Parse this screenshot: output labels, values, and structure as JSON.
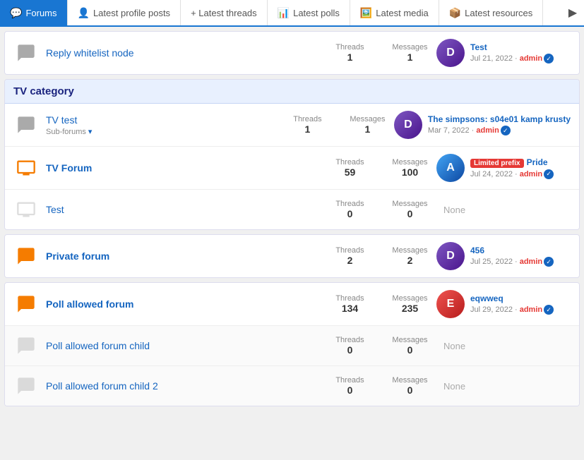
{
  "nav": {
    "items": [
      {
        "id": "forums",
        "label": "Forums",
        "icon": "💬",
        "active": true
      },
      {
        "id": "profile-posts",
        "label": "Latest profile posts",
        "icon": "👤"
      },
      {
        "id": "latest-threads",
        "label": "+ Latest threads",
        "icon": ""
      },
      {
        "id": "latest-polls",
        "label": "Latest polls",
        "icon": "📊"
      },
      {
        "id": "latest-media",
        "label": "Latest media",
        "icon": "🖼️"
      },
      {
        "id": "latest-resources",
        "label": "Latest resources",
        "icon": "📦"
      }
    ],
    "more_icon": "▶"
  },
  "forums": [
    {
      "id": "reply-whitelist",
      "title": "Reply whitelist node",
      "title_bold": false,
      "icon_type": "chat_gray",
      "sub_forums": null,
      "threads": 1,
      "messages": 1,
      "latest": {
        "title": "Test",
        "date": "Jul 21, 2022",
        "author": "admin",
        "avatar": "1",
        "prefix": null
      },
      "category": null
    },
    {
      "id": "tv-category",
      "category_title": "TV category",
      "children": [
        {
          "id": "tv-test",
          "title": "TV test",
          "title_bold": false,
          "icon_type": "chat_gray",
          "sub_forums": "Sub-forums ▾",
          "threads": 1,
          "messages": 1,
          "latest": {
            "title": "The simpsons: s04e01 kamp krusty",
            "date": "Mar 7, 2022",
            "author": "admin",
            "avatar": "1",
            "prefix": null
          }
        },
        {
          "id": "tv-forum",
          "title": "TV Forum",
          "title_bold": true,
          "icon_type": "tv_orange",
          "sub_forums": null,
          "threads": 59,
          "messages": 100,
          "latest": {
            "title": "Pride",
            "date": "Jul 24, 2022",
            "author": "admin",
            "avatar": "2",
            "prefix": "Limited prefix"
          }
        },
        {
          "id": "test",
          "title": "Test",
          "title_bold": false,
          "icon_type": "tv_gray",
          "sub_forums": null,
          "threads": 0,
          "messages": 0,
          "latest": null
        }
      ]
    },
    {
      "id": "private-forum",
      "title": "Private forum",
      "title_bold": true,
      "icon_type": "chat_orange",
      "sub_forums": null,
      "threads": 2,
      "messages": 2,
      "latest": {
        "title": "456",
        "date": "Jul 25, 2022",
        "author": "admin",
        "avatar": "1",
        "prefix": null
      },
      "category": null
    },
    {
      "id": "poll-allowed-forum",
      "title": "Poll allowed forum",
      "title_bold": true,
      "icon_type": "chat_orange",
      "sub_forums": null,
      "threads": 134,
      "messages": 235,
      "latest": {
        "title": "eqwweq",
        "date": "Jul 29, 2022",
        "author": "admin",
        "avatar": "3",
        "prefix": null
      },
      "category": null
    },
    {
      "id": "poll-allowed-child",
      "title": "Poll allowed forum child",
      "title_bold": false,
      "icon_type": "chat_gray",
      "sub_forums": null,
      "threads": 0,
      "messages": 0,
      "latest": null,
      "category": null
    },
    {
      "id": "poll-allowed-child-2",
      "title": "Poll allowed forum child 2",
      "title_bold": false,
      "icon_type": "chat_gray",
      "sub_forums": null,
      "threads": 0,
      "messages": 0,
      "latest": null,
      "category": null
    }
  ],
  "labels": {
    "threads": "Threads",
    "messages": "Messages",
    "none": "None"
  }
}
